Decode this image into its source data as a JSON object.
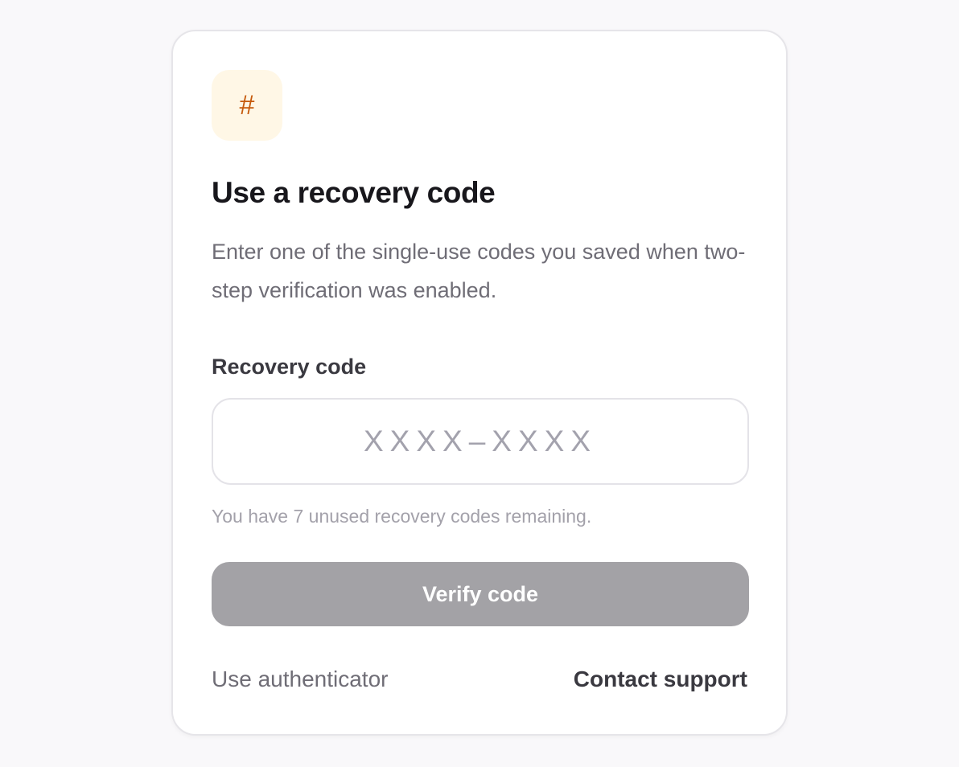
{
  "badge": {
    "glyph": "#",
    "icon": "hash-icon",
    "color": "#c65a0c",
    "background": "#fff7e6"
  },
  "title": "Use a recovery code",
  "description": "Enter one of the single-use codes you saved when two-step verification was enabled.",
  "field": {
    "label": "Recovery code",
    "value": "",
    "placeholder": "XXXX–XXXX"
  },
  "hint": "You have 7 unused recovery codes remaining.",
  "verify_button": {
    "label": "Verify code",
    "state": "disabled"
  },
  "links": {
    "use_authenticator": "Use authenticator",
    "contact_support": "Contact support"
  }
}
